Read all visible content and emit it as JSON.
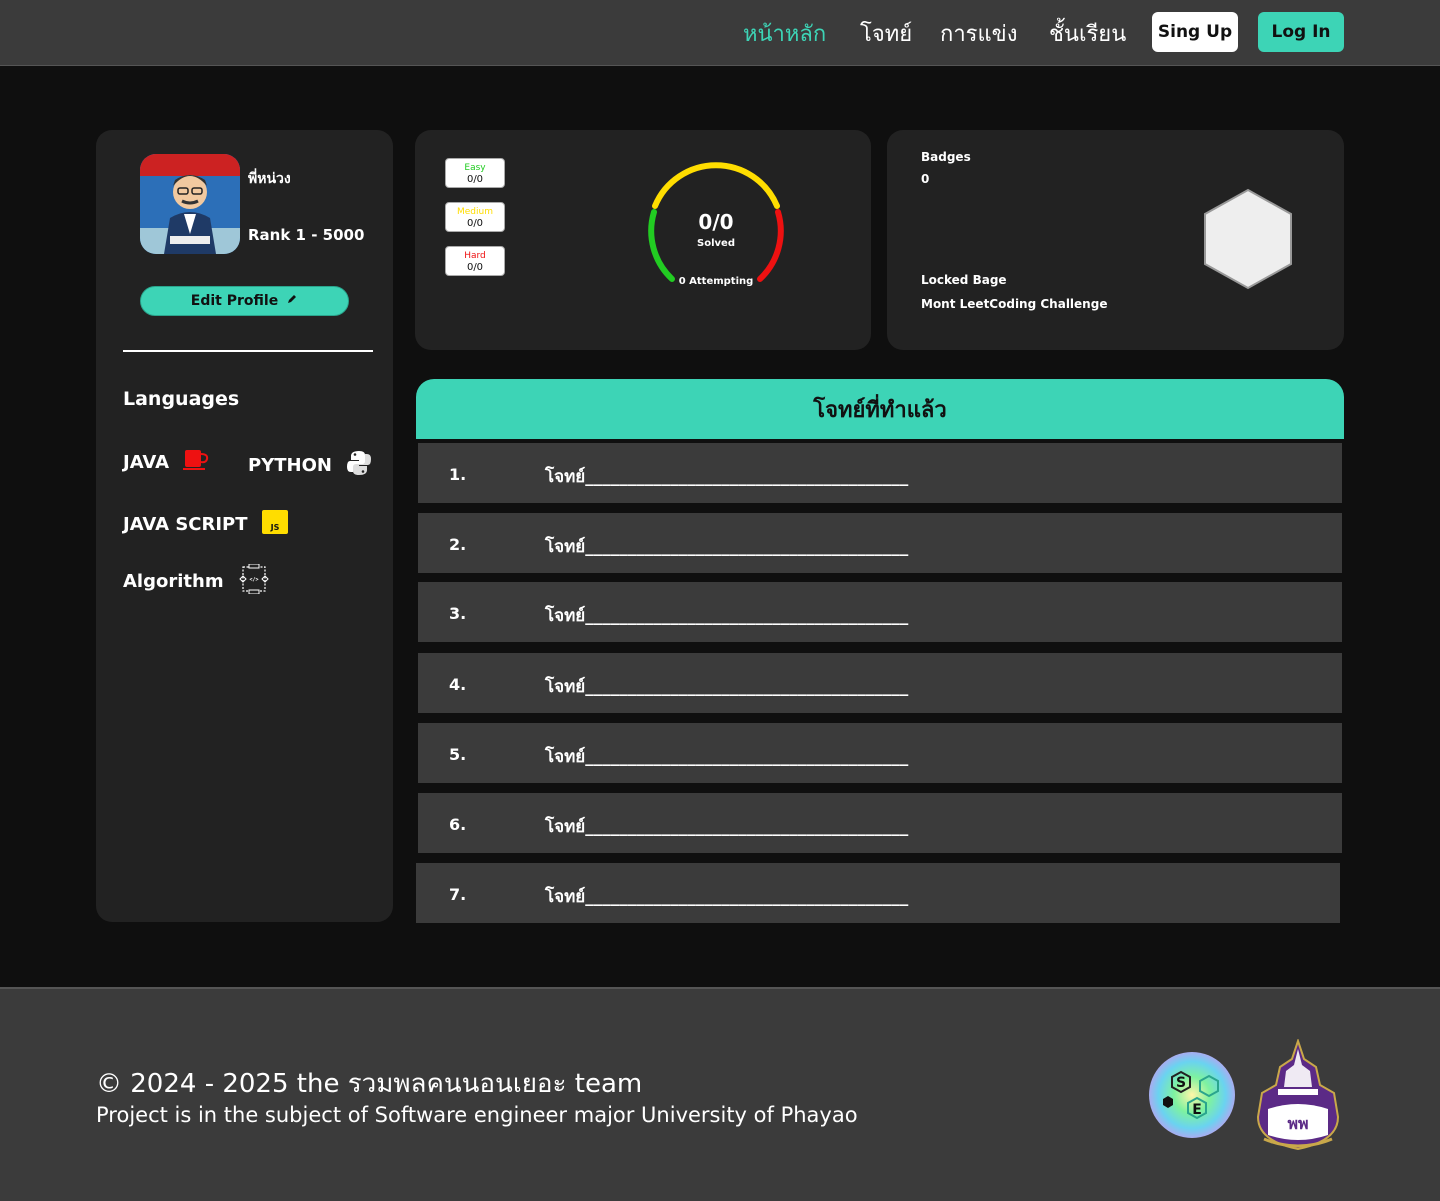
{
  "nav": {
    "items": [
      "หน้าหลัก",
      "โจทย์",
      "การแข่ง",
      "ชั้นเรียน"
    ],
    "signup_label": "Sing Up",
    "login_label": "Log In"
  },
  "profile": {
    "username": "พี่หน่วง",
    "rank": "Rank 1 - 5000",
    "edit_label": "Edit Profile"
  },
  "languages": {
    "title": "Languages",
    "items": [
      "JAVA",
      "PYTHON",
      "JAVA SCRIPT",
      "Algorithm"
    ]
  },
  "stats": {
    "easy_label": "Easy",
    "easy_value": "0/0",
    "medium_label": "Medium",
    "medium_value": "0/0",
    "hard_label": "Hard",
    "hard_value": "0/0",
    "solved_value": "0/0",
    "solved_label": "Solved",
    "attempting": "0 Attempting"
  },
  "badges": {
    "title": "Badges",
    "count": "0",
    "locked_title": "Locked Bage",
    "locked_name": "Mont LeetCoding Challenge"
  },
  "problems": {
    "header": "โจทย์ที่ทำแล้ว",
    "rows": [
      {
        "num": "1.",
        "text": "โจทย์______________________________________"
      },
      {
        "num": "2.",
        "text": "โจทย์______________________________________"
      },
      {
        "num": "3.",
        "text": "โจทย์______________________________________"
      },
      {
        "num": "4.",
        "text": "โจทย์______________________________________"
      },
      {
        "num": "5.",
        "text": "โจทย์______________________________________"
      },
      {
        "num": "6.",
        "text": "โจทย์______________________________________"
      },
      {
        "num": "7.",
        "text": "โจทย์______________________________________"
      }
    ]
  },
  "footer": {
    "copyright": "© 2024 - 2025 the รวมพลคนนอนเยอะ team",
    "project": "Project is in the subject of Software engineer major University of Phayao"
  },
  "colors": {
    "accent": "#3dd4b6",
    "header_bg": "#3b3b3b",
    "card_bg": "#222222",
    "easy": "#22cc22",
    "medium": "#ffdd00",
    "hard": "#ee1111"
  }
}
